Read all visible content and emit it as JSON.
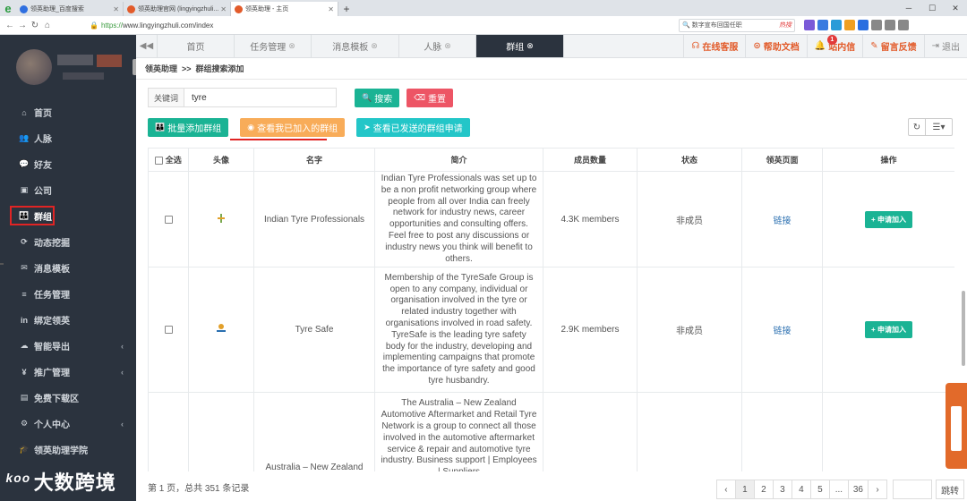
{
  "browser": {
    "tabs": [
      {
        "title": "领英助理_百度搜索",
        "active": false,
        "color": "#2f6fe0"
      },
      {
        "title": "领英助理官网 (lingyingzhuli...",
        "active": false,
        "color": "#e25b2a"
      },
      {
        "title": "领英助理 - 主页",
        "active": true,
        "color": "#e25b2a"
      }
    ],
    "new_tab": "+",
    "url_proto": "https://",
    "url_rest": "www.lingyingzhuli.com/index",
    "search_text": "数字宣布回国任职",
    "search_hot": "热搜"
  },
  "sidebar": {
    "items": [
      {
        "icon": "⌂",
        "label": "首页"
      },
      {
        "icon": "👥",
        "label": "人脉"
      },
      {
        "icon": "💬",
        "label": "好友"
      },
      {
        "icon": "▣",
        "label": "公司"
      },
      {
        "icon": "👪",
        "label": "群组",
        "active": true
      },
      {
        "icon": "⟳",
        "label": "动态挖掘"
      },
      {
        "icon": "✉",
        "label": "消息模板"
      },
      {
        "icon": "≡",
        "label": "任务管理"
      },
      {
        "icon": "in",
        "label": "绑定领英"
      },
      {
        "icon": "☁",
        "label": "智能导出",
        "chevron": "‹"
      },
      {
        "icon": "¥",
        "label": "推广管理",
        "chevron": "‹"
      },
      {
        "icon": "▤",
        "label": "免费下载区"
      },
      {
        "icon": "⚙",
        "label": "个人中心",
        "chevron": "‹"
      },
      {
        "icon": "🎓",
        "label": "领英助理学院"
      }
    ],
    "watermark": "大数跨境",
    "watermark_logo": "ᵏᵒᵒ"
  },
  "toptabs": {
    "back": "◀◀",
    "tabs": [
      {
        "label": "首页",
        "closable": false
      },
      {
        "label": "任务管理",
        "closable": true
      },
      {
        "label": "消息模板",
        "closable": true,
        "wide": true
      },
      {
        "label": "人脉",
        "closable": true
      },
      {
        "label": "群组",
        "closable": true,
        "active": true
      }
    ],
    "close_glyph": "⊗",
    "tools": [
      {
        "icon": "☊",
        "label": "在线客服"
      },
      {
        "icon": "⊙",
        "label": "帮助文档"
      },
      {
        "icon": "🔔",
        "label": "站内信",
        "badge": "1"
      },
      {
        "icon": "✎",
        "label": "留言反馈"
      },
      {
        "icon": "⇥",
        "label": "退出",
        "gray": true
      }
    ]
  },
  "breadcrumb": {
    "root": "领英助理",
    "sep": ">>",
    "current": "群组搜索添加"
  },
  "filter": {
    "label": "关键词",
    "value": "tyre",
    "search_btn": "搜索",
    "reset_btn": "重置"
  },
  "actions": {
    "batch_add": "批量添加群组",
    "view_joined": "查看我已加入的群组",
    "view_sent": "查看已发送的群组申请"
  },
  "table": {
    "headers": [
      "全选",
      "头像",
      "名字",
      "简介",
      "成员数量",
      "状态",
      "领英页面",
      "操作"
    ],
    "rows": [
      {
        "name": "Indian Tyre Professionals",
        "intro": "Indian Tyre Professionals was set up to be a non profit networking group where people from all over India can freely network for industry news, career opportunities and consulting offers. Feel free to post any discussions or industry news you think will benefit to others.",
        "members": "4.3K members",
        "status": "非成员",
        "link": "链接",
        "action": "+ 申请加入",
        "logo_color": "#7aa84e"
      },
      {
        "name": "Tyre Safe",
        "intro": "Membership of the TyreSafe Group is open to any company, individual or organisation involved in the tyre or related industry together with organisations involved in road safety. TyreSafe is the leading tyre safety body for the industry, developing and implementing campaigns that promote the importance of tyre safety and good tyre husbandry.",
        "members": "2.9K members",
        "status": "非成员",
        "link": "链接",
        "action": "+ 申请加入",
        "logo_color": "#e2a02a"
      },
      {
        "name": "Australia – New Zealand",
        "intro": "The Australia – New Zealand Automotive Aftermarket and Retail Tyre Network is a group to connect all those involved in the automotive aftermarket service & repair and automotive tyre industry. Business support | Employees | Suppliers",
        "members": "",
        "status": "",
        "link": "",
        "action": "",
        "logo_color": "#ffffff"
      }
    ]
  },
  "footer": {
    "summary": "第 1 页，总共 351 条记录"
  },
  "pager": {
    "prev": "‹",
    "pages": [
      "1",
      "2",
      "3",
      "4",
      "5",
      "...",
      "36"
    ],
    "next": "›",
    "jump": "跳转"
  }
}
